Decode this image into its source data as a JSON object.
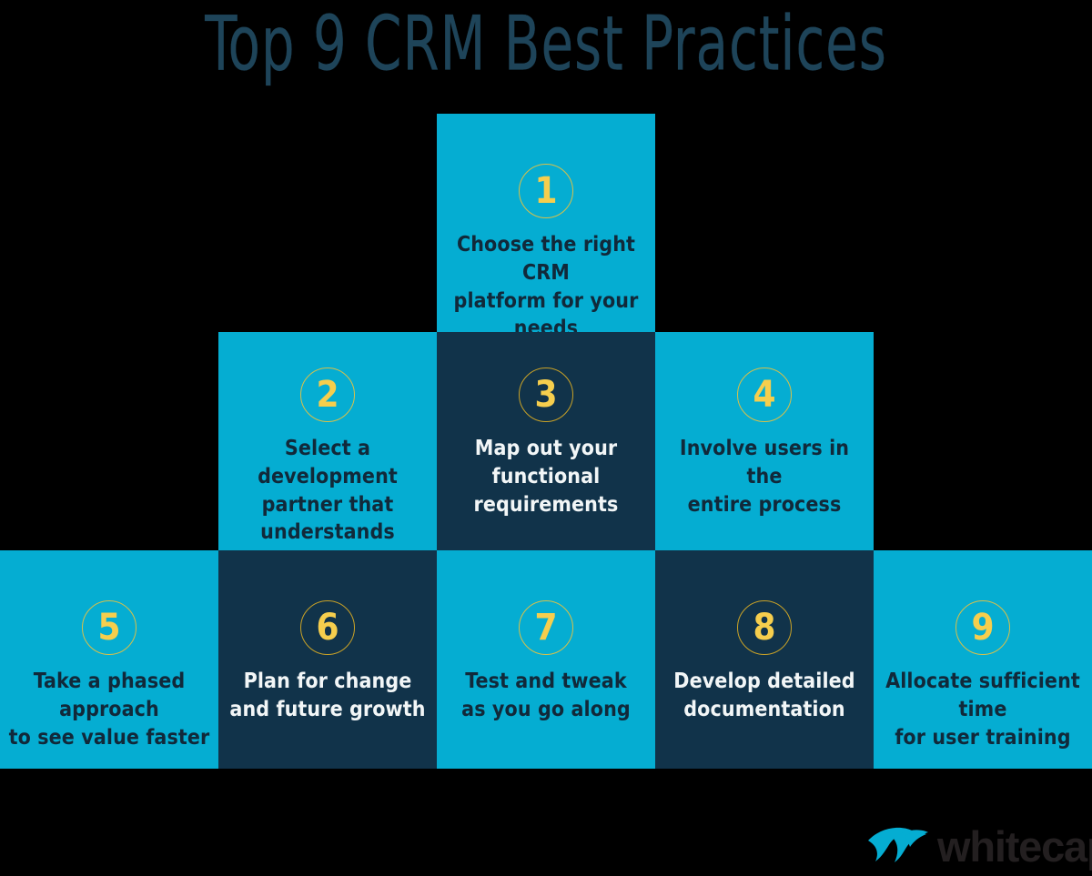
{
  "title": "Top 9 CRM Best Practices",
  "colors": {
    "background": "#000000",
    "cyan": "#05add2",
    "navy": "#11334A",
    "yellow": "#f6ce4d",
    "circle_stroke": "#c9a227",
    "title": "#1e4459",
    "text_on_cyan": "#11293a",
    "text_on_navy": "#f2f6f7",
    "logo_mark": "#05add2",
    "logo_word": "#231f20"
  },
  "cells": [
    {
      "number": "1",
      "text": "Choose the right CRM\nplatform for your needs",
      "theme": "cyan"
    },
    {
      "number": "2",
      "text": "Select a development\npartner that understands\nyour business",
      "theme": "cyan"
    },
    {
      "number": "3",
      "text": "Map out your\nfunctional requirements",
      "theme": "navy"
    },
    {
      "number": "4",
      "text": "Involve users in the\nentire process",
      "theme": "cyan"
    },
    {
      "number": "5",
      "text": "Take a phased approach\nto see value faster",
      "theme": "cyan"
    },
    {
      "number": "6",
      "text": "Plan for change\nand future growth",
      "theme": "navy"
    },
    {
      "number": "7",
      "text": "Test and tweak\nas you go along",
      "theme": "cyan"
    },
    {
      "number": "8",
      "text": "Develop detailed\ndocumentation",
      "theme": "navy"
    },
    {
      "number": "9",
      "text": "Allocate sufficient time\nfor user training",
      "theme": "cyan"
    }
  ],
  "logo": {
    "wordmark": "whitecap",
    "mark_icon": "whitecap-wave-icon"
  }
}
